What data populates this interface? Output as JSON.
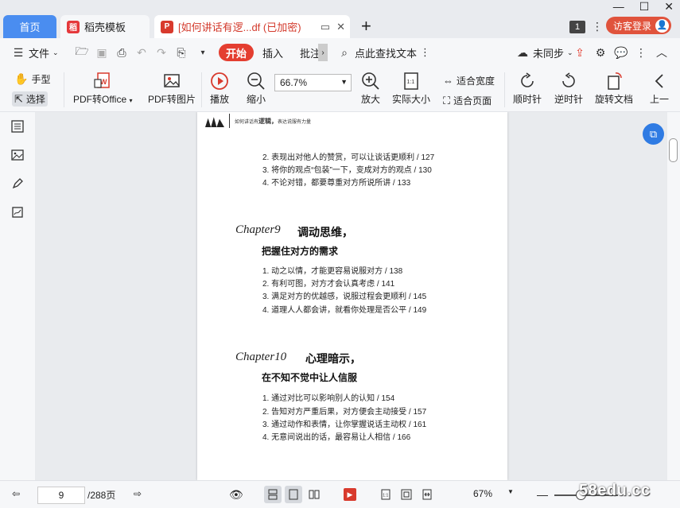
{
  "tabs": {
    "home": "首页",
    "template": "稻壳模板",
    "document": "[如何讲话有逻...df (已加密)",
    "new_tab": "+"
  },
  "header_right": {
    "badge_number": "1",
    "visitor_login": "访客登录"
  },
  "menu": {
    "file": "文件",
    "start": "开始",
    "insert": "插入",
    "annotate": "批注",
    "search_text": "点此查找文本",
    "sync": "未同步"
  },
  "ribbon": {
    "hand_tool": "手型",
    "select_tool": "选择",
    "pdf_to_office": "PDF转Office",
    "pdf_to_image": "PDF转图片",
    "play": "播放",
    "zoom_out": "缩小",
    "zoom_value": "66.7%",
    "zoom_in": "放大",
    "actual_size": "实际大小",
    "fit_width": "适合宽度",
    "fit_page": "适合页面",
    "rotate_cw": "顺时针",
    "rotate_ccw": "逆时针",
    "rotate_doc": "旋转文档",
    "prev": "上一"
  },
  "document_page": {
    "header_text_small": "如何讲话有",
    "header_text_big": "逻辑，",
    "header_text_tail": "表达说服有力量",
    "top_items": [
      "2. 表现出对他人的赞赏，可以让谈话更顺利 / 127",
      "3. 将你的观点“包装”一下，变成对方的观点 / 130",
      "4. 不论对错，都要尊重对方所说所讲 / 133"
    ],
    "chapter9": {
      "label": "Chapter9",
      "title": "调动思维，",
      "subtitle": "把握住对方的需求",
      "items": [
        "1. 动之以情，才能更容易说服对方 / 138",
        "2. 有利可图，对方才会认真考虑 / 141",
        "3. 满足对方的优越感，说服过程会更顺利 / 145",
        "4. 道理人人都会讲，就看你处理是否公平 / 149"
      ]
    },
    "chapter10": {
      "label": "Chapter10",
      "title": "心理暗示，",
      "subtitle": "在不知不觉中让人信服",
      "items": [
        "1. 通过对比可以影响别人的认知 / 154",
        "2. 告知对方严重后果，对方便会主动接受 / 157",
        "3. 通过动作和表情，让你掌握说话主动权 / 161",
        "4. 无意间说出的话，最容易让人相信 / 166"
      ]
    }
  },
  "status": {
    "current_page": "9",
    "total_pages": "/288页",
    "zoom_percent": "67%"
  },
  "watermark": "58edu.cc",
  "colors": {
    "accent_red": "#e43e30",
    "home_tab_blue": "#4a8df0",
    "float_button_blue": "#2f7be3"
  }
}
